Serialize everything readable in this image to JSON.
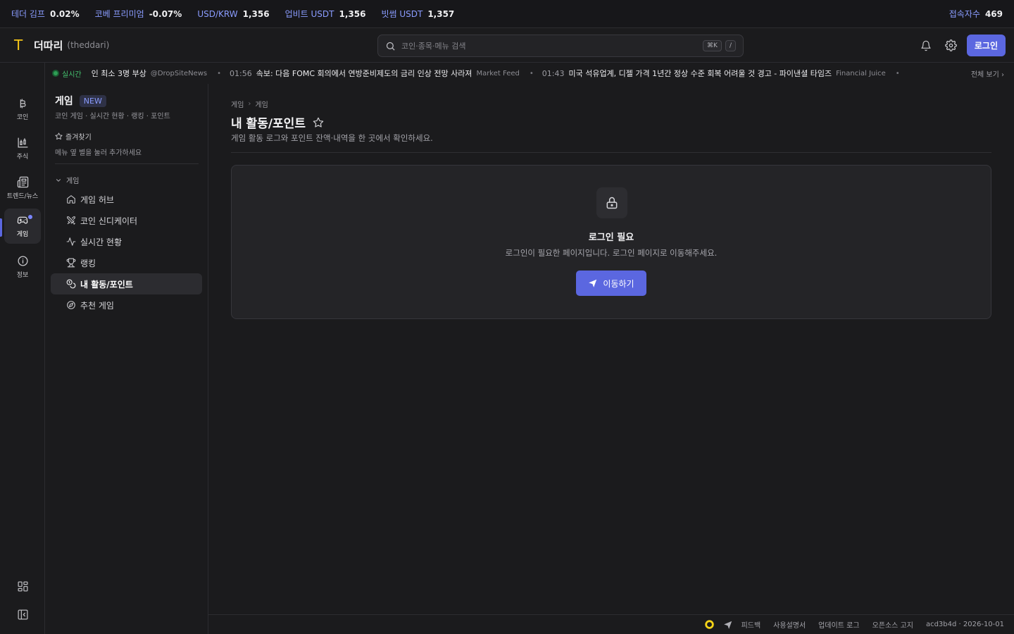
{
  "ticker": {
    "items": [
      {
        "label": "테더 김프",
        "value": "0.02%"
      },
      {
        "label": "코베 프리미엄",
        "value": "-0.07%"
      },
      {
        "label": "USD/KRW",
        "value": "1,356"
      },
      {
        "label": "업비트 USDT",
        "value": "1,356"
      },
      {
        "label": "빗썸 USDT",
        "value": "1,357"
      }
    ],
    "visitors_label": "접속자수",
    "visitors_value": "469"
  },
  "header": {
    "logo_mark": "T",
    "brand": "더따리",
    "brand_sub": "(theddari)",
    "search_placeholder": "코인·종목·메뉴 검색",
    "kbd1": "⌘K",
    "kbd2": "/",
    "login_label": "로그인"
  },
  "rail": {
    "items": [
      {
        "label": "코인",
        "icon": "bitcoin-icon"
      },
      {
        "label": "주식",
        "icon": "chart-icon"
      },
      {
        "label": "트렌드/뉴스",
        "icon": "newspaper-icon"
      },
      {
        "label": "게임",
        "icon": "gamepad-icon"
      },
      {
        "label": "정보",
        "icon": "info-icon"
      }
    ]
  },
  "news": {
    "live_label": "실시간",
    "items": [
      {
        "time": "",
        "headline": "인 최소 3명 부상",
        "source": "@DropSiteNews"
      },
      {
        "time": "01:56",
        "headline": "속보: 다음 FOMC 회의에서 연방준비제도의 금리 인상 전망 사라져",
        "source": "Market Feed"
      },
      {
        "time": "01:43",
        "headline": "미국 석유업계, 디젤 가격 1년간 정상 수준 회복 어려울 것 경고 - 파이낸셜 타임즈",
        "source": "Financial Juice"
      }
    ],
    "see_all": "전체 보기"
  },
  "sidebar": {
    "title": "게임",
    "badge": "NEW",
    "desc": "코인 게임 · 실시간 현황 · 랭킹 · 포인트",
    "fav_title": "즐겨찾기",
    "fav_desc": "메뉴 옆 별을 눌러 추가하세요",
    "group": "게임",
    "items": [
      {
        "label": "게임 허브",
        "icon": "home-icon"
      },
      {
        "label": "코인 신디케이터",
        "icon": "swords-icon"
      },
      {
        "label": "실시간 현황",
        "icon": "activity-icon"
      },
      {
        "label": "랭킹",
        "icon": "trophy-icon"
      },
      {
        "label": "내 활동/포인트",
        "icon": "coins-icon"
      },
      {
        "label": "추천 게임",
        "icon": "compass-icon"
      }
    ]
  },
  "main": {
    "breadcrumb": [
      "게임",
      "게임"
    ],
    "title": "내 활동/포인트",
    "desc": "게임 활동 로그와 포인트 잔액·내역을 한 곳에서 확인하세요.",
    "card": {
      "title": "로그인 필요",
      "desc": "로그인이 필요한 페이지입니다. 로그인 페이지로 이동해주세요.",
      "button": "이동하기"
    }
  },
  "footer": {
    "links": [
      "피드백",
      "사용설명서",
      "업데이트 로그",
      "오픈소스 고지"
    ],
    "version": "acd3b4d · 2026-10-01"
  },
  "colors": {
    "accent": "#5b67e0",
    "ticker_label": "#8a9cff",
    "live": "#44c16e",
    "logo": "#f5c518"
  }
}
